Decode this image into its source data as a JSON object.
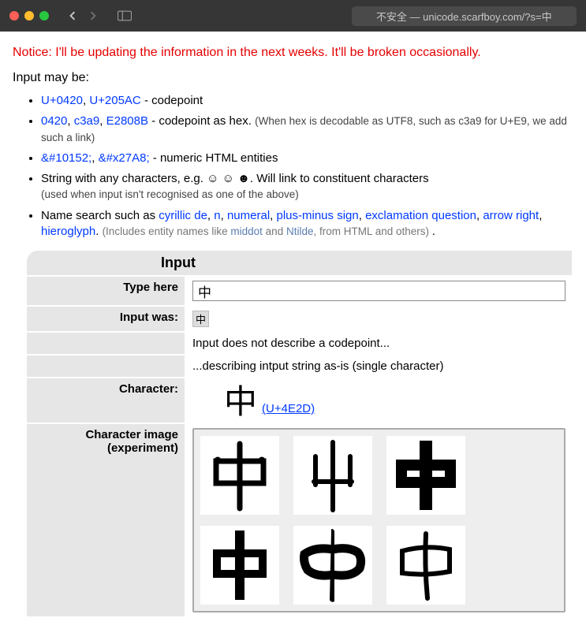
{
  "browser": {
    "address": "不安全 — unicode.scarfboy.com/?s=中"
  },
  "notice": "Notice: I'll be updating the information in the next weeks. It'll be broken occasionally.",
  "intro_label": "Input may be:",
  "bullets": {
    "b1": {
      "a": "U+0420",
      "b": "U+205AC",
      "tail": " - codepoint"
    },
    "b2": {
      "a": "0420",
      "b": "c3a9",
      "c": "E2808B",
      "tail": " - codepoint as hex. ",
      "note": "(When hex is decodable as UTF8, such as c3a9 for U+E9, we add such a link)"
    },
    "b3": {
      "a": "&#10152;",
      "b": "&#x27A8;",
      "tail": " - numeric HTML entities"
    },
    "b4": {
      "lead": "String with any characters, e.g. ",
      "symbols": "☺ ☺ ☻",
      "tail": ". Will link to constituent characters",
      "note": "(used when input isn't recognised as one of the above)"
    },
    "b5": {
      "lead": "Name search such as ",
      "a": "cyrillic de",
      "b": "n",
      "c": "numeral",
      "d": "plus-minus sign",
      "e": "exclamation question",
      "f": "arrow right",
      "g": "hieroglyph",
      "note_lead": " (Includes entity names like ",
      "note_a": "middot",
      "note_mid": " and ",
      "note_b": "Ntilde",
      "note_tail": ", from HTML and others)"
    }
  },
  "panel": {
    "section_title": "Input",
    "type_here_label": "Type here",
    "type_here_value": "中",
    "input_was_label": "Input was:",
    "input_was_value": "中",
    "msg1": "Input does not describe a codepoint...",
    "msg2": "...describing intput string as-is (single character)",
    "character_label": "Character:",
    "big_char": "中",
    "code_link": "(U+4E2D)",
    "image_label_1": "Character image",
    "image_label_2": "(experiment)"
  }
}
